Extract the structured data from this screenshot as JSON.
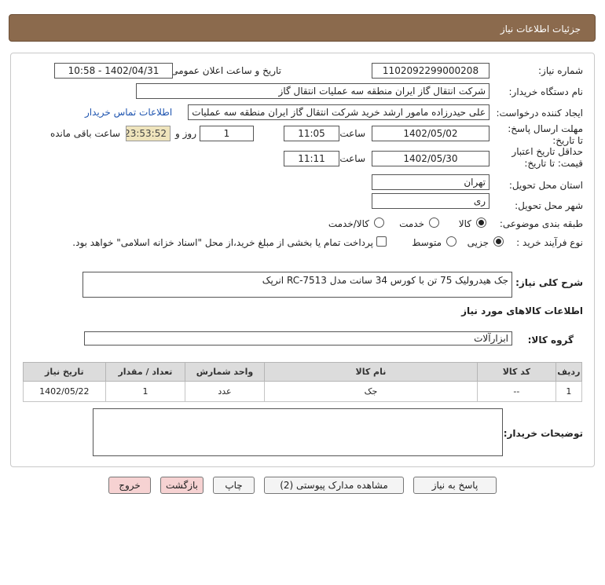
{
  "header": {
    "title": "جزئیات اطلاعات نیاز"
  },
  "labels": {
    "need_number": "شماره نیاز:",
    "announce_datetime": "تاریخ و ساعت اعلان عمومی:",
    "buyer_org": "نام دستگاه خریدار:",
    "requester": "ایجاد کننده درخواست:",
    "contact_link": "اطلاعات تماس خریدار",
    "reply_deadline": "مهلت ارسال پاسخ: تا تاریخ:",
    "time_word": "ساعت",
    "day_and": "روز و",
    "remaining": "ساعت باقی مانده",
    "price_validity": "حداقل تاریخ اعتبار قیمت: تا تاریخ:",
    "province": "استان محل تحویل:",
    "city": "شهر محل تحویل:",
    "category": "طبقه بندی موضوعی:",
    "purchase_type": "نوع فرآیند خرید :",
    "need_desc": "شرح کلی نیاز:",
    "goods_info": "اطلاعات کالاهای مورد نیاز",
    "goods_group": "گروه کالا:",
    "buyer_notes": "توضیحات خریدار:"
  },
  "values": {
    "need_number": "1102092299000208",
    "announce_datetime": "1402/04/31 - 10:58",
    "buyer_org": "شرکت انتقال گاز ایران منطقه سه عملیات انتقال گاز",
    "requester": "علی حیدرزاده مامور ارشد خرید شرکت انتقال گاز ایران منطقه سه عملیات انتقال",
    "reply_date": "1402/05/02",
    "reply_time": "11:05",
    "reply_days": "1",
    "reply_remaining": "23:53:52",
    "validity_date": "1402/05/30",
    "validity_time": "11:11",
    "province": "تهران",
    "city": "ری",
    "need_desc": "جک هیدرولیک 75 تن با کورس 34 سانت مدل RC-7513 انرپک",
    "goods_group": "ابزارآلات",
    "buyer_notes": ""
  },
  "category_options": [
    {
      "label": "کالا",
      "selected": true
    },
    {
      "label": "خدمت",
      "selected": false
    },
    {
      "label": "کالا/خدمت",
      "selected": false
    }
  ],
  "purchase_options": [
    {
      "label": "جزیی",
      "selected": true
    },
    {
      "label": "متوسط",
      "selected": false
    }
  ],
  "payment_note": "پرداخت تمام یا بخشی از مبلغ خرید،از محل \"اسناد خزانه اسلامی\" خواهد بود.",
  "table": {
    "headers": [
      "ردیف",
      "کد کالا",
      "نام کالا",
      "واحد شمارش",
      "تعداد / مقدار",
      "تاریخ نیاز"
    ],
    "rows": [
      [
        "1",
        "--",
        "جک",
        "عدد",
        "1",
        "1402/05/22"
      ]
    ]
  },
  "buttons": {
    "reply": "پاسخ به نیاز",
    "attachments": "مشاهده مدارک پیوستی (2)",
    "print": "چاپ",
    "back": "بازگشت",
    "exit": "خروج"
  },
  "colors": {
    "header_bg": "#8b6a4d",
    "timer_bg": "#efe4bc",
    "link": "#1f55b0"
  }
}
